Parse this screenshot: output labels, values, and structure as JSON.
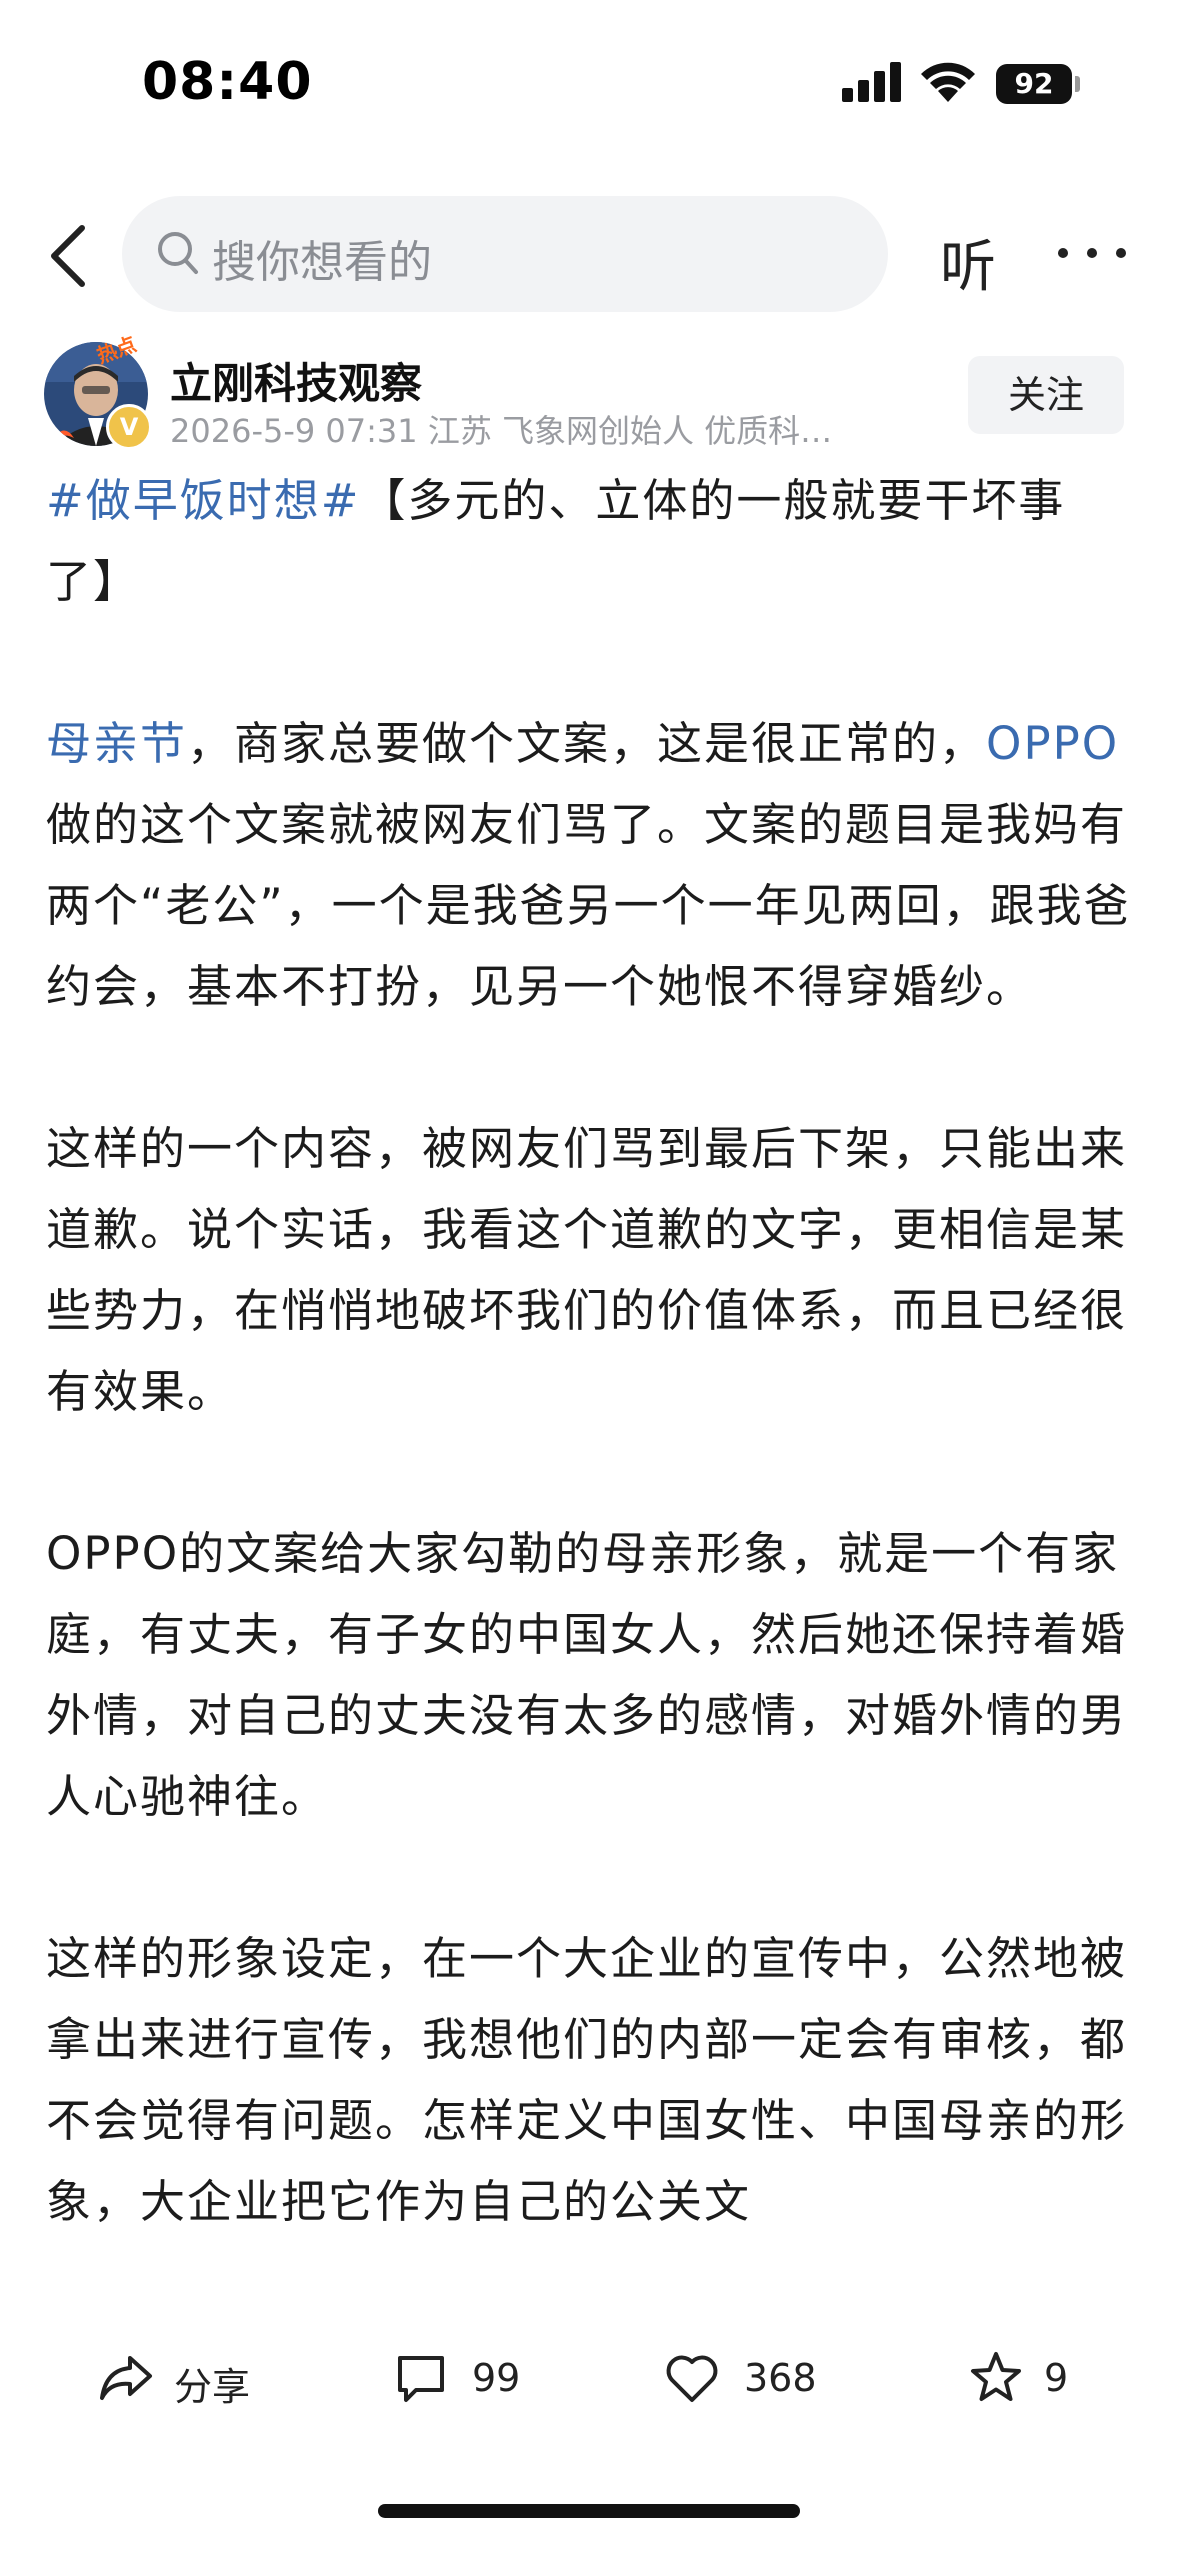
{
  "status_bar": {
    "time": "08:40",
    "battery": "92"
  },
  "top_bar": {
    "search_placeholder": "搜你想看的",
    "listen_label": "听"
  },
  "author": {
    "name": "立刚科技观察",
    "meta": "2026-5-9 07:31  江苏  飞象网创始人 优质科…",
    "badge": "热点",
    "verified": "V",
    "follow_label": "关注"
  },
  "article": {
    "title_tag": "#做早饭时想#",
    "title_text": "【多元的、立体的一般就要干坏事了】",
    "p1_link1": "母亲节",
    "p1_text1": "，商家总要做个文案，这是很正常的，",
    "p1_link2": "OPPO",
    "p1_text2": "做的这个文案就被网友们骂了。文案的题目是我妈有两个“老公”，一个是我爸另一个一年见两回，跟我爸约会，基本不打扮，见另一个她恨不得穿婚纱。",
    "p2": "这样的一个内容，被网友们骂到最后下架，只能出来道歉。说个实话，我看这个道歉的文字，更相信是某些势力，在悄悄地破坏我们的价值体系，而且已经很有效果。",
    "p3": "OPPO的文案给大家勾勒的母亲形象，就是一个有家庭，有丈夫，有子女的中国女人，然后她还保持着婚外情，对自己的丈夫没有太多的感情，对婚外情的男人心驰神往。",
    "p4": "这样的形象设定，在一个大企业的宣传中，公然地被拿出来进行宣传，我想他们的内部一定会有审核，都不会觉得有问题。怎样定义中国女性、中国母亲的形象，大企业把它作为自己的公关文"
  },
  "actions": {
    "share_label": "分享",
    "comments": "99",
    "likes": "368",
    "favorites": "9"
  },
  "icons": [
    "back-icon",
    "search-icon",
    "more-icon",
    "share-icon",
    "comment-icon",
    "like-icon",
    "favorite-icon",
    "signal-icon",
    "wifi-icon"
  ]
}
